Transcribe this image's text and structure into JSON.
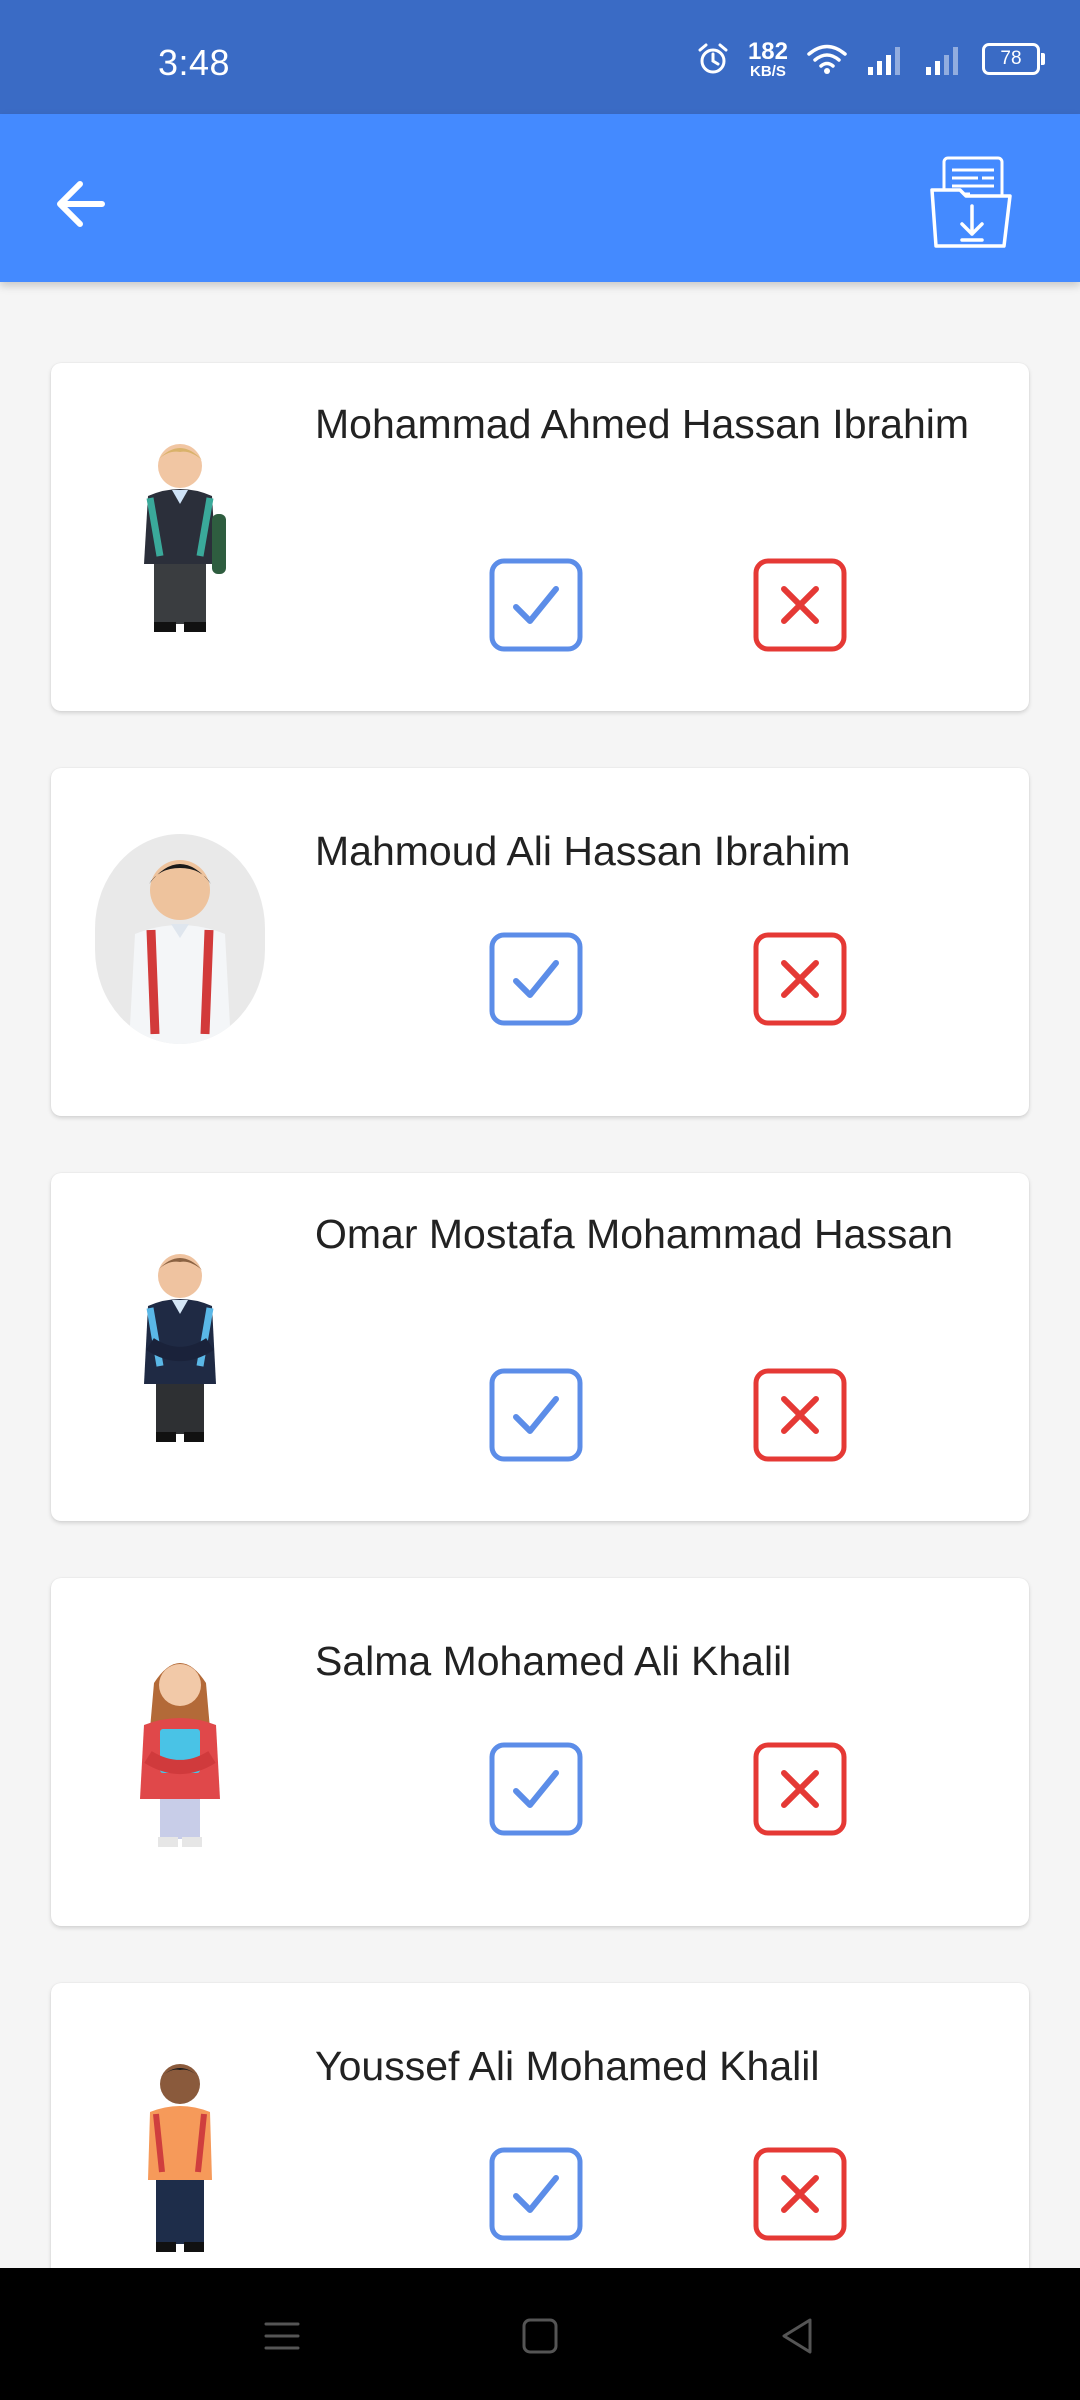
{
  "status_bar": {
    "time": "3:48",
    "net_speed_value": "182",
    "net_speed_unit": "KB/S",
    "battery": "78",
    "icons": [
      "alarm-icon",
      "wifi-icon",
      "signal-icon",
      "signal-icon"
    ]
  },
  "app_bar": {
    "back_icon": "arrow-back-icon",
    "action_icon": "download-report-icon",
    "color": "#448aff"
  },
  "students": [
    {
      "name": "Mohammad Ahmed Hassan Ibrahim"
    },
    {
      "name": "Mahmoud Ali Hassan Ibrahim"
    },
    {
      "name": "Omar Mostafa Mohammad Hassan"
    },
    {
      "name": "Salma Mohamed Ali Khalil"
    },
    {
      "name": "Youssef Ali Mohamed Khalil"
    }
  ],
  "actions": {
    "present_icon": "check-icon",
    "absent_icon": "cross-icon",
    "present_color": "#5c8de8",
    "absent_color": "#e53935"
  },
  "nav_bar": {
    "icons": [
      "menu-icon",
      "home-icon",
      "back-icon"
    ]
  }
}
